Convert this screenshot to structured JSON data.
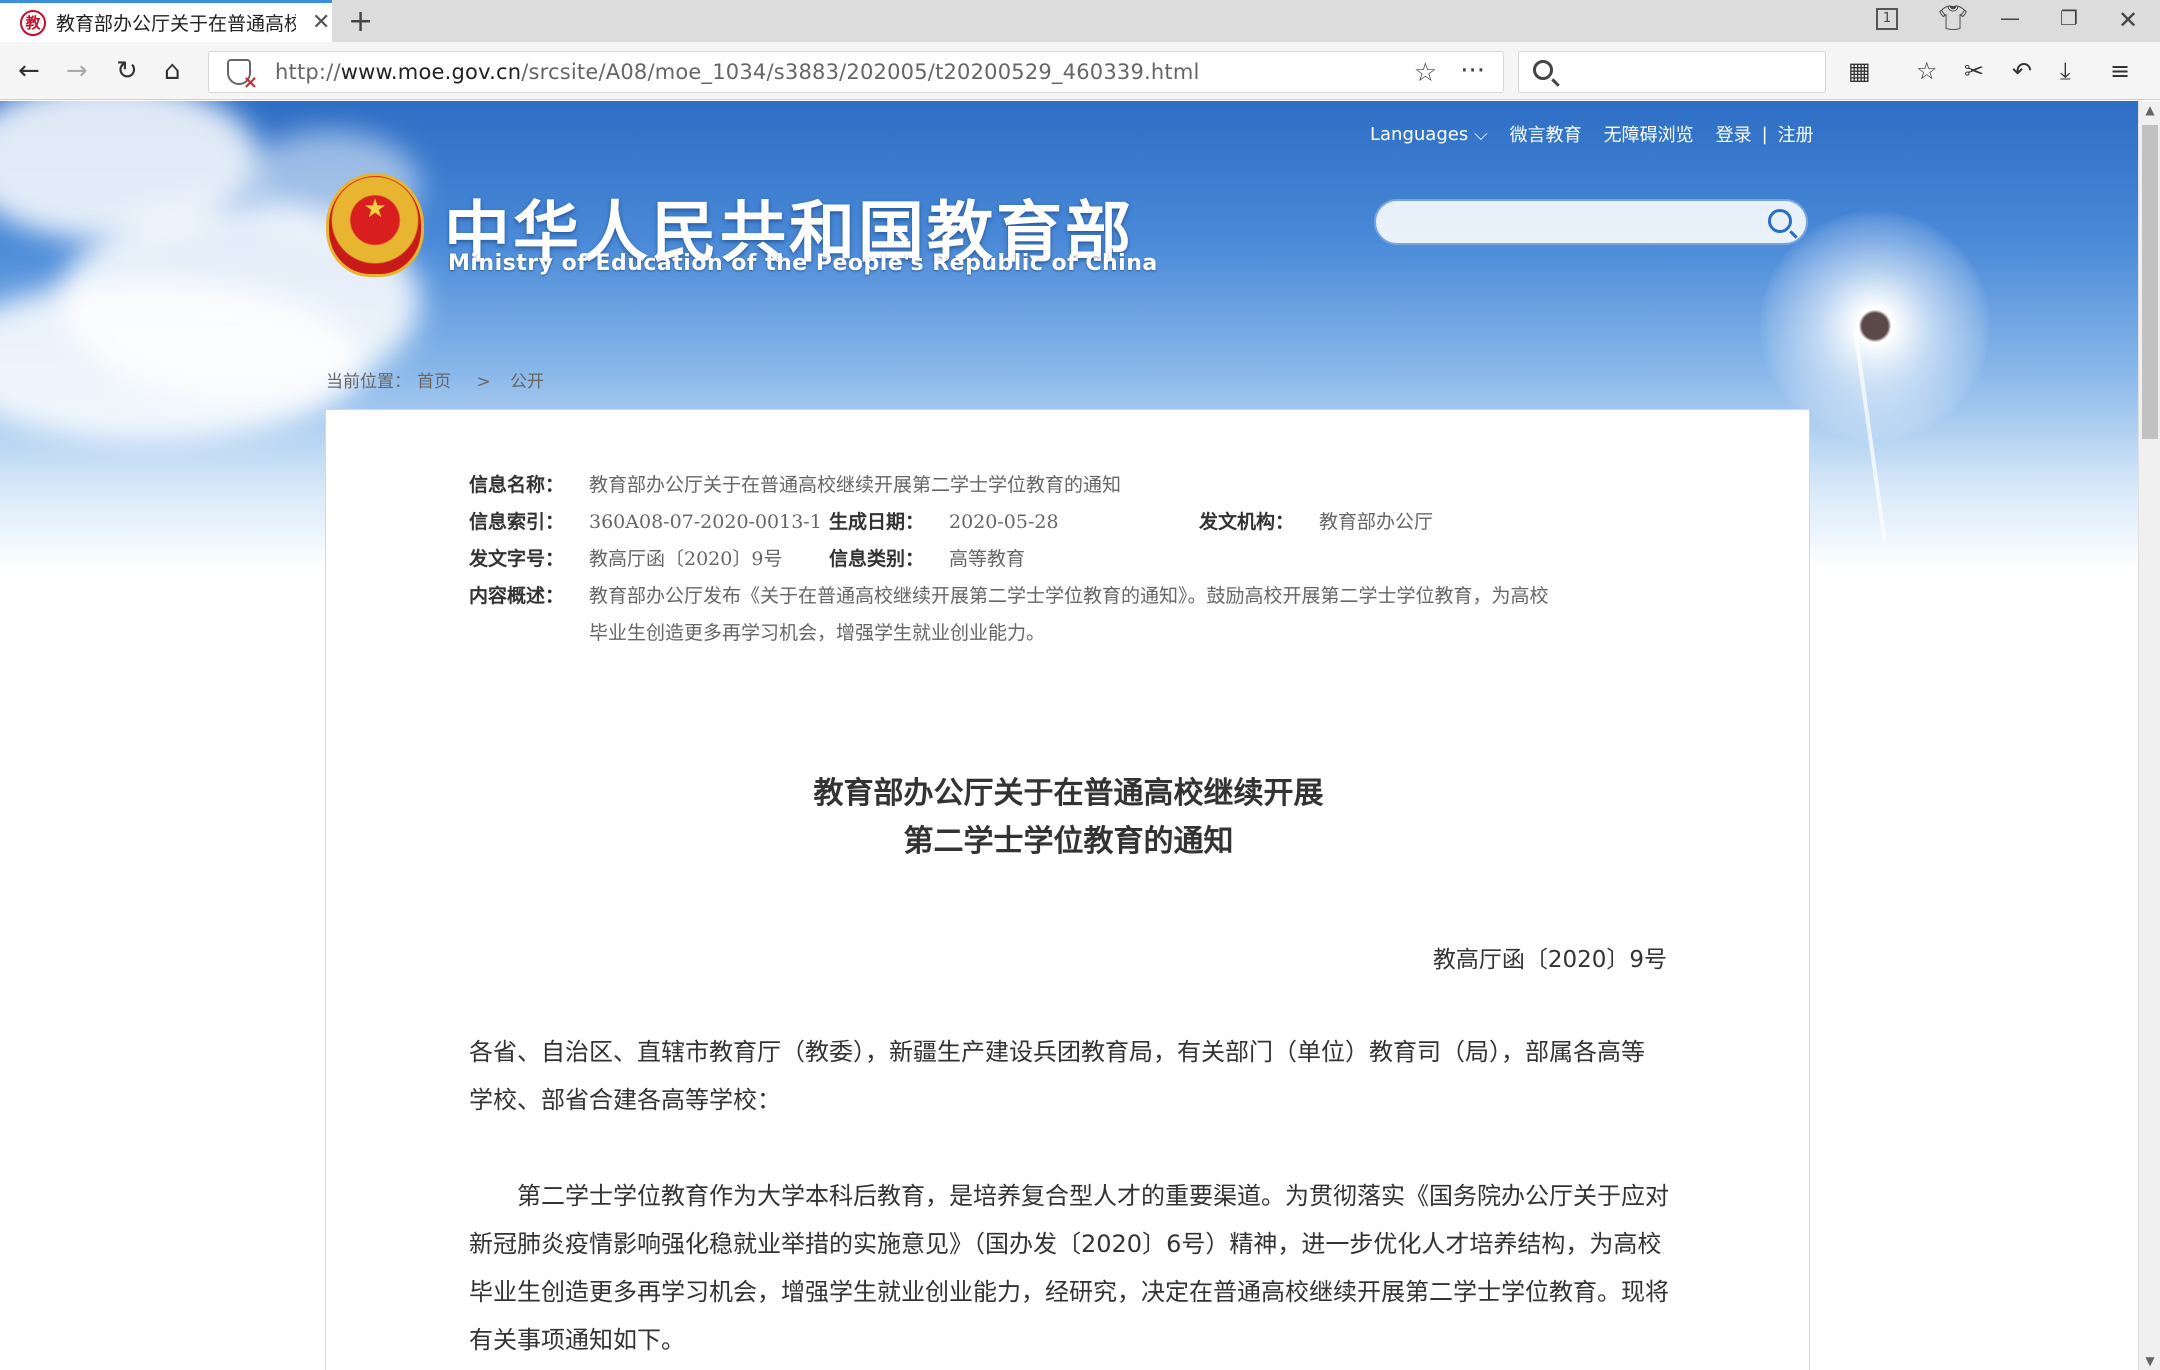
{
  "browser": {
    "tab_title": "教育部办公厅关于在普通高校",
    "tab_favicon": "教",
    "tab_count": "1",
    "url_prefix": "http://",
    "url_host": "www.moe.gov.cn",
    "url_path": "/srcsite/A08/moe_1034/s3883/202005/t20200529_460339.html",
    "more_glyph": "···"
  },
  "site": {
    "links": {
      "languages": "Languages",
      "weiyan": "微言教育",
      "accessible": "无障碍浏览",
      "login": "登录",
      "separator": "|",
      "register": "注册"
    },
    "title_cn": "中华人民共和国教育部",
    "title_en": "Ministry of Education of the People's Republic of China"
  },
  "breadcrumb": {
    "prefix": "当前位置：",
    "home": "首页",
    "arrow": ">",
    "current": "公开"
  },
  "meta": {
    "name_label": "信息名称：",
    "name_value": "教育部办公厅关于在普通高校继续开展第二学士学位教育的通知",
    "index_label": "信息索引：",
    "index_value": "360A08-07-2020-0013-1",
    "date_label": "生成日期：",
    "date_value": "2020-05-28",
    "org_label": "发文机构：",
    "org_value": "教育部办公厅",
    "doc_no_label": "发文字号：",
    "doc_no_value": "教高厅函〔2020〕9号",
    "category_label": "信息类别：",
    "category_value": "高等教育",
    "summary_label": "内容概述：",
    "summary_line1": "教育部办公厅发布《关于在普通高校继续开展第二学士学位教育的通知》。鼓励高校开展第二学士学位教育，为高校",
    "summary_line2": "毕业生创造更多再学习机会，增强学生就业创业能力。"
  },
  "document": {
    "title_line1": "教育部办公厅关于在普通高校继续开展",
    "title_line2": "第二学士学位教育的通知",
    "number": "教高厅函〔2020〕9号",
    "salutation_line1": "各省、自治区、直辖市教育厅（教委），新疆生产建设兵团教育局，有关部门（单位）教育司（局），部属各高等",
    "salutation_line2": "学校、部省合建各高等学校：",
    "para1_line1": "第二学士学位教育作为大学本科后教育，是培养复合型人才的重要渠道。为贯彻落实《国务院办公厅关于应对",
    "para1_line2": "新冠肺炎疫情影响强化稳就业举措的实施意见》（国办发〔2020〕6号）精神，进一步优化人才培养结构，为高校",
    "para1_line3": "毕业生创造更多再学习机会，增强学生就业创业能力，经研究，决定在普通高校继续开展第二学士学位教育。现将",
    "para1_line4": "有关事项通知如下。"
  },
  "colors": {
    "tab_accent": "#3c8fe0",
    "banner_top": "#2d6dc4",
    "emblem_red": "#d81e1e",
    "emblem_gold": "#e8b531"
  }
}
